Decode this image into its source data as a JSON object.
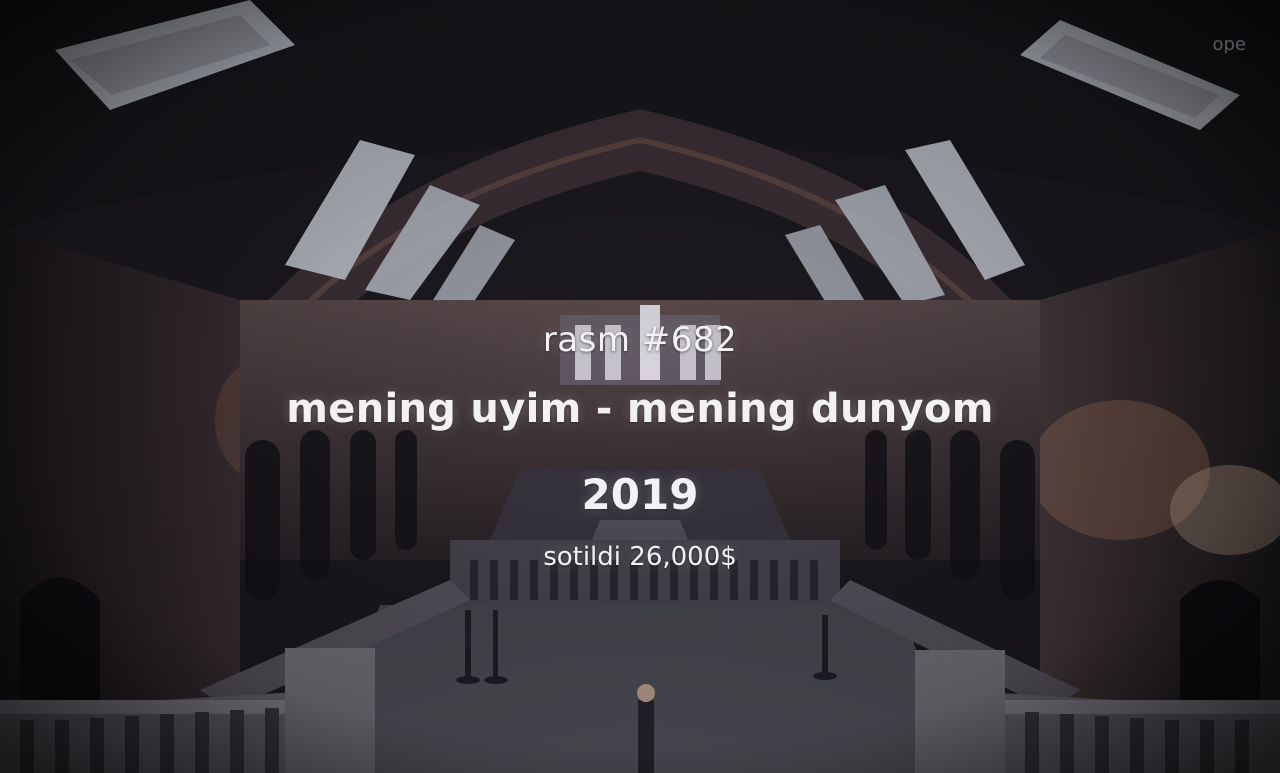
{
  "caption": {
    "number": "rasm #682",
    "title": "mening uyim - mening dunyom",
    "year": "2019",
    "sold": "sotildi 26,000$"
  },
  "corner_text": "ope",
  "colors": {
    "text": "#f3f1f4",
    "shadow": "#141319",
    "stone": "#3a3238",
    "warm_light": "#b07860",
    "skylight": "#cfd3dc"
  }
}
